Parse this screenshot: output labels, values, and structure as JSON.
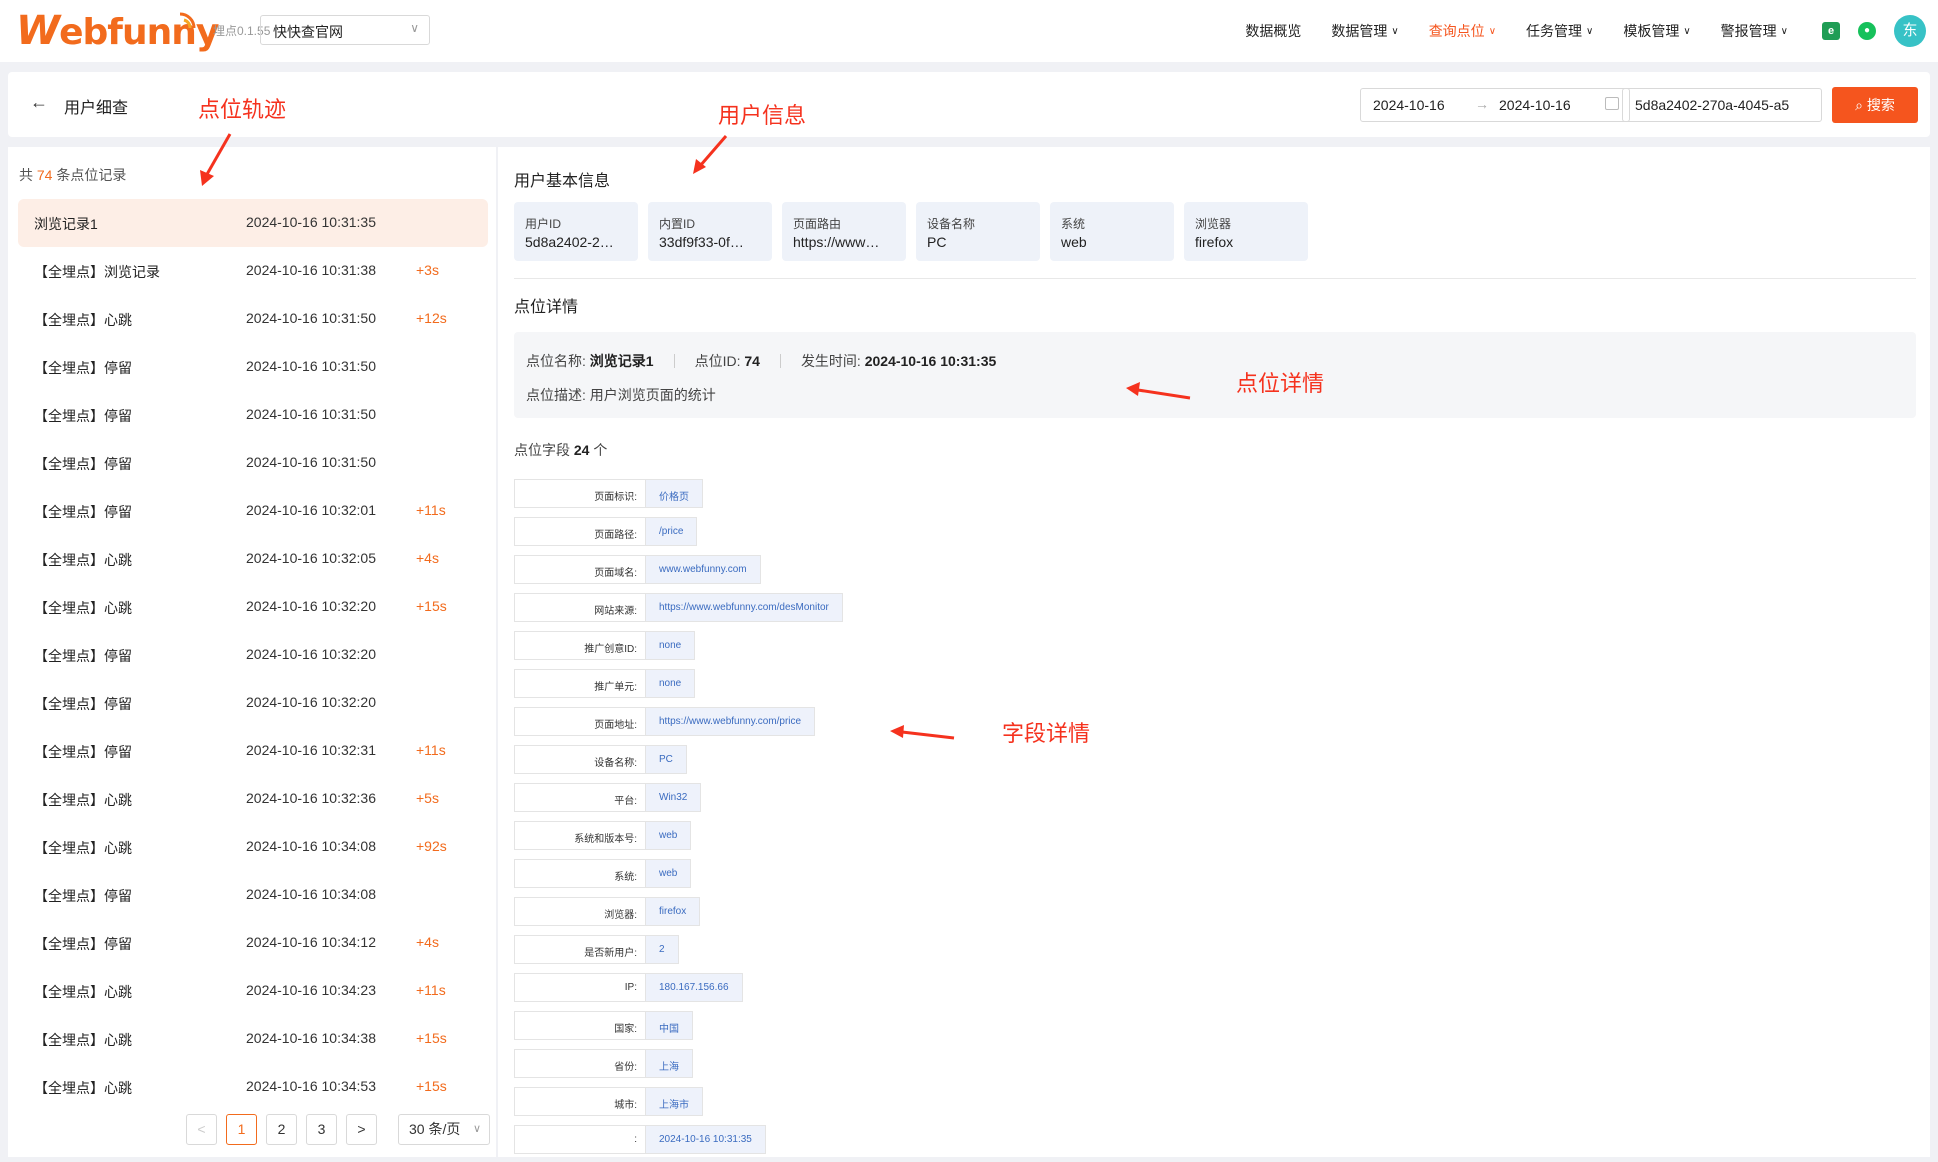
{
  "nav": {
    "logo_w": "W",
    "logo_rest": "ebfunny",
    "version": "埋点0.1.55",
    "project": "快快查官网",
    "menu": [
      {
        "label": "数据概览",
        "caret": false,
        "active": false
      },
      {
        "label": "数据管理",
        "caret": true,
        "active": false
      },
      {
        "label": "查询点位",
        "caret": true,
        "active": true
      },
      {
        "label": "任务管理",
        "caret": true,
        "active": false
      },
      {
        "label": "模板管理",
        "caret": true,
        "active": false
      },
      {
        "label": "警报管理",
        "caret": true,
        "active": false
      }
    ],
    "avatar": "东"
  },
  "header": {
    "back": "←",
    "title": "用户细查",
    "date_start": "2024-10-16",
    "date_sep": "→",
    "date_end": "2024-10-16",
    "uid_value": "5d8a2402-270a-4045-a5",
    "search_label": "搜索"
  },
  "records": {
    "prefix": "共",
    "count": "74",
    "suffix": "条点位记录",
    "items": [
      {
        "name": "浏览记录1",
        "time": "2024-10-16 10:31:35",
        "diff": ""
      },
      {
        "name": "【全埋点】浏览记录",
        "time": "2024-10-16 10:31:38",
        "diff": "+3s"
      },
      {
        "name": "【全埋点】心跳",
        "time": "2024-10-16 10:31:50",
        "diff": "+12s"
      },
      {
        "name": "【全埋点】停留",
        "time": "2024-10-16 10:31:50",
        "diff": ""
      },
      {
        "name": "【全埋点】停留",
        "time": "2024-10-16 10:31:50",
        "diff": ""
      },
      {
        "name": "【全埋点】停留",
        "time": "2024-10-16 10:31:50",
        "diff": ""
      },
      {
        "name": "【全埋点】停留",
        "time": "2024-10-16 10:32:01",
        "diff": "+11s"
      },
      {
        "name": "【全埋点】心跳",
        "time": "2024-10-16 10:32:05",
        "diff": "+4s"
      },
      {
        "name": "【全埋点】心跳",
        "time": "2024-10-16 10:32:20",
        "diff": "+15s"
      },
      {
        "name": "【全埋点】停留",
        "time": "2024-10-16 10:32:20",
        "diff": ""
      },
      {
        "name": "【全埋点】停留",
        "time": "2024-10-16 10:32:20",
        "diff": ""
      },
      {
        "name": "【全埋点】停留",
        "time": "2024-10-16 10:32:31",
        "diff": "+11s"
      },
      {
        "name": "【全埋点】心跳",
        "time": "2024-10-16 10:32:36",
        "diff": "+5s"
      },
      {
        "name": "【全埋点】心跳",
        "time": "2024-10-16 10:34:08",
        "diff": "+92s"
      },
      {
        "name": "【全埋点】停留",
        "time": "2024-10-16 10:34:08",
        "diff": ""
      },
      {
        "name": "【全埋点】停留",
        "time": "2024-10-16 10:34:12",
        "diff": "+4s"
      },
      {
        "name": "【全埋点】心跳",
        "time": "2024-10-16 10:34:23",
        "diff": "+11s"
      },
      {
        "name": "【全埋点】心跳",
        "time": "2024-10-16 10:34:38",
        "diff": "+15s"
      },
      {
        "name": "【全埋点】心跳",
        "time": "2024-10-16 10:34:53",
        "diff": "+15s"
      }
    ],
    "pager": {
      "prev": "<",
      "pages": [
        "1",
        "2",
        "3"
      ],
      "current": "1",
      "next": ">",
      "page_size": "30 条/页"
    }
  },
  "user_info": {
    "title": "用户基本信息",
    "cards": [
      {
        "label": "用户ID",
        "value": "5d8a2402-2…"
      },
      {
        "label": "内置ID",
        "value": "33df9f33-0f…"
      },
      {
        "label": "页面路由",
        "value": "https://www…"
      },
      {
        "label": "设备名称",
        "value": "PC"
      },
      {
        "label": "系统",
        "value": "web"
      },
      {
        "label": "浏览器",
        "value": "firefox"
      }
    ]
  },
  "point_detail": {
    "title": "点位详情",
    "name_label": "点位名称:",
    "name_value": "浏览记录1",
    "id_label": "点位ID:",
    "id_value": "74",
    "time_label": "发生时间:",
    "time_value": "2024-10-16 10:31:35",
    "desc_label": "点位描述:",
    "desc_value": "用户浏览页面的统计"
  },
  "fields": {
    "title_prefix": "点位字段",
    "count": "24",
    "title_suffix": "个",
    "items": [
      {
        "key": "页面标识:",
        "value": "价格页"
      },
      {
        "key": "页面路径:",
        "value": "/price"
      },
      {
        "key": "页面域名:",
        "value": "www.webfunny.com"
      },
      {
        "key": "网站来源:",
        "value": "https://www.webfunny.com/desMonitor"
      },
      {
        "key": "推广创意ID:",
        "value": "none"
      },
      {
        "key": "推广单元:",
        "value": "none"
      },
      {
        "key": "页面地址:",
        "value": "https://www.webfunny.com/price"
      },
      {
        "key": "设备名称:",
        "value": "PC"
      },
      {
        "key": "平台:",
        "value": "Win32"
      },
      {
        "key": "系统和版本号:",
        "value": "web"
      },
      {
        "key": "系统:",
        "value": "web"
      },
      {
        "key": "浏览器:",
        "value": "firefox"
      },
      {
        "key": "是否新用户:",
        "value": "2"
      },
      {
        "key": "IP:",
        "value": "180.167.156.66"
      },
      {
        "key": "国家:",
        "value": "中国"
      },
      {
        "key": "省份:",
        "value": "上海"
      },
      {
        "key": "城市:",
        "value": "上海市"
      },
      {
        "key": ":",
        "value": "2024-10-16 10:31:35"
      }
    ]
  },
  "annotations": {
    "track": "点位轨迹",
    "user": "用户信息",
    "detail": "点位详情",
    "field": "字段详情"
  },
  "colors": {
    "accent": "#f26b1d",
    "annotation": "#f5321e",
    "field_value": "#3a6bc0"
  }
}
